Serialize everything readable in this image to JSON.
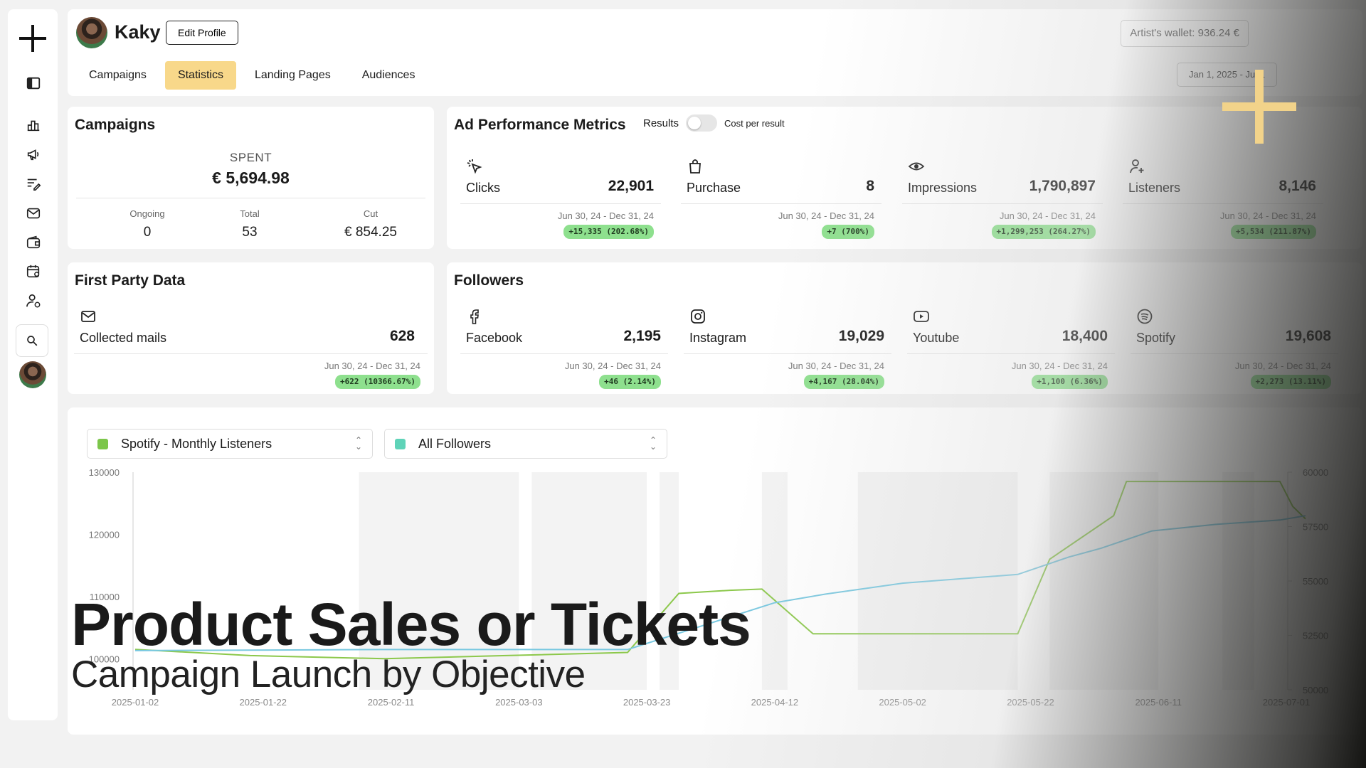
{
  "brand": {
    "accent": "#f8d88a",
    "badge_green": "#8ee08e"
  },
  "sidebar": {
    "items": [
      {
        "icon": "logo-icon"
      },
      {
        "icon": "sidebar-toggle-icon"
      },
      {
        "icon": "chart-icon"
      },
      {
        "icon": "megaphone-icon"
      },
      {
        "icon": "list-edit-icon"
      },
      {
        "icon": "mail-icon"
      },
      {
        "icon": "wallet-icon"
      },
      {
        "icon": "calendar-user-icon"
      },
      {
        "icon": "user-settings-icon"
      }
    ]
  },
  "header": {
    "name": "Kaky",
    "edit_label": "Edit Profile",
    "tabs": [
      "Campaigns",
      "Statistics",
      "Landing Pages",
      "Audiences"
    ],
    "active_tab": "Statistics",
    "wallet": "Artist's wallet: 936.24 €",
    "date_range": "Jan 1, 2025 - Jul 1"
  },
  "campaigns": {
    "title": "Campaigns",
    "spent_label": "SPENT",
    "spent_value": "€ 5,694.98",
    "stats": [
      {
        "label": "Ongoing",
        "value": "0"
      },
      {
        "label": "Total",
        "value": "53"
      },
      {
        "label": "Cut",
        "value": "€ 854.25"
      }
    ]
  },
  "ad_metrics": {
    "title": "Ad Performance Metrics",
    "toggle_left": "Results",
    "toggle_right": "Cost per result",
    "items": [
      {
        "icon": "click-icon",
        "label": "Clicks",
        "value": "22,901",
        "range": "Jun 30, 24 - Dec 31, 24",
        "delta": "+15,335  (202.68%)"
      },
      {
        "icon": "shopping-bag-icon",
        "label": "Purchase",
        "value": "8",
        "range": "Jun 30, 24 - Dec 31, 24",
        "delta": "+7  (700%)"
      },
      {
        "icon": "eye-icon",
        "label": "Impressions",
        "value": "1,790,897",
        "range": "Jun 30, 24 - Dec 31, 24",
        "delta": "+1,299,253  (264.27%)"
      },
      {
        "icon": "user-plus-icon",
        "label": "Listeners",
        "value": "8,146",
        "range": "Jun 30, 24 - Dec 31, 24",
        "delta": "+5,534  (211.87%)"
      }
    ]
  },
  "first_party": {
    "title": "First Party Data",
    "item": {
      "icon": "mail-icon",
      "label": "Collected mails",
      "value": "628",
      "range": "Jun 30, 24 - Dec 31, 24",
      "delta": "+622  (10366.67%)"
    }
  },
  "followers": {
    "title": "Followers",
    "items": [
      {
        "icon": "facebook-icon",
        "label": "Facebook",
        "value": "2,195",
        "range": "Jun 30, 24 - Dec 31, 24",
        "delta": "+46  (2.14%)"
      },
      {
        "icon": "instagram-icon",
        "label": "Instagram",
        "value": "19,029",
        "range": "Jun 30, 24 - Dec 31, 24",
        "delta": "+4,167  (28.04%)"
      },
      {
        "icon": "youtube-icon",
        "label": "Youtube",
        "value": "18,400",
        "range": "Jun 30, 24 - Dec 31, 24",
        "delta": "+1,100  (6.36%)"
      },
      {
        "icon": "spotify-icon",
        "label": "Spotify",
        "value": "19,608",
        "range": "Jun 30, 24 - Dec 31, 24",
        "delta": "+2,273  (13.11%)"
      }
    ]
  },
  "chart_controls": {
    "left_select": {
      "label": "Spotify - Monthly Listeners",
      "color": "#7cc64a"
    },
    "right_select": {
      "label": "All Followers",
      "color": "#5fd3b8"
    }
  },
  "chart_data": {
    "type": "line",
    "x_ticks": [
      "2025-01-02",
      "2025-01-22",
      "2025-02-11",
      "2025-03-03",
      "2025-03-23",
      "2025-04-12",
      "2025-05-02",
      "2025-05-22",
      "2025-06-11",
      "2025-07-01"
    ],
    "y_left_ticks": [
      "130000",
      "120000",
      "110000",
      "100000"
    ],
    "y_right_ticks": [
      "60000",
      "57500",
      "55000",
      "52500",
      "50000"
    ],
    "y_left_range": [
      95000,
      130000
    ],
    "y_right_range": [
      50000,
      60000
    ],
    "series": [
      {
        "name": "Spotify - Monthly Listeners",
        "axis": "left",
        "color": "#8cc84b",
        "x": [
          "2025-01-02",
          "2025-01-20",
          "2025-02-10",
          "2025-03-01",
          "2025-03-20",
          "2025-03-28",
          "2025-04-05",
          "2025-04-10",
          "2025-04-18",
          "2025-04-22",
          "2025-05-20",
          "2025-05-25",
          "2025-06-04",
          "2025-06-06",
          "2025-06-30",
          "2025-07-02",
          "2025-07-04"
        ],
        "values": [
          101500,
          100500,
          100000,
          100500,
          101000,
          110500,
          111000,
          111200,
          104000,
          104000,
          104000,
          116000,
          123000,
          128500,
          128500,
          124500,
          122500
        ]
      },
      {
        "name": "All Followers",
        "axis": "right",
        "color": "#78c8e0",
        "x": [
          "2025-01-02",
          "2025-02-10",
          "2025-03-20",
          "2025-04-12",
          "2025-04-20",
          "2025-05-02",
          "2025-05-20",
          "2025-05-28",
          "2025-06-02",
          "2025-06-10",
          "2025-06-20",
          "2025-06-30",
          "2025-07-04"
        ],
        "values": [
          51800,
          51850,
          51850,
          54000,
          54400,
          54900,
          55300,
          56100,
          56500,
          57300,
          57600,
          57800,
          58000
        ]
      }
    ]
  },
  "overlay": {
    "title": "Product Sales or Tickets",
    "subtitle": "Campaign Launch by Objective"
  }
}
